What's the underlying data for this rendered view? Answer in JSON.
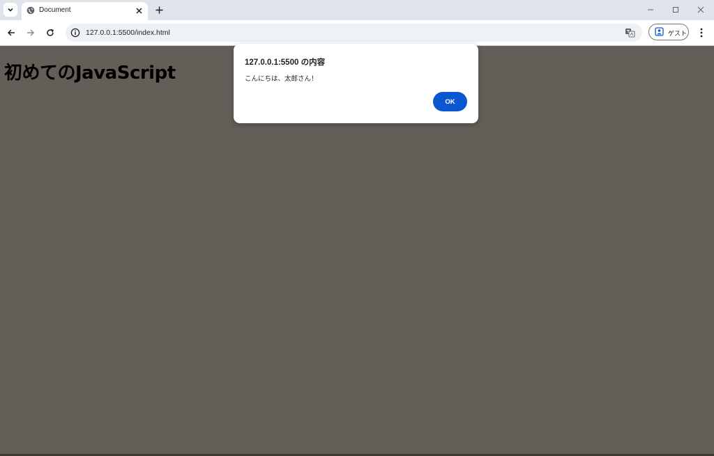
{
  "tab": {
    "title": "Document"
  },
  "omnibox": {
    "url": "127.0.0.1:5500/index.html"
  },
  "profile": {
    "label": "ゲスト"
  },
  "page": {
    "heading": "初めてのJavaScript"
  },
  "dialog": {
    "title": "127.0.0.1:5500 の内容",
    "message": "こんにちは、太郎さん！",
    "ok_label": "OK"
  },
  "colors": {
    "page_background": "#645e58",
    "tabstrip": "#dfe3eb",
    "accent": "#0b57d0"
  },
  "icons": [
    "chevron-down-icon",
    "globe-icon",
    "close-icon",
    "plus-icon",
    "minimize-icon",
    "maximize-icon",
    "back-arrow-icon",
    "forward-arrow-icon",
    "reload-icon",
    "info-icon",
    "translate-icon",
    "person-icon",
    "kebab-menu-icon"
  ]
}
